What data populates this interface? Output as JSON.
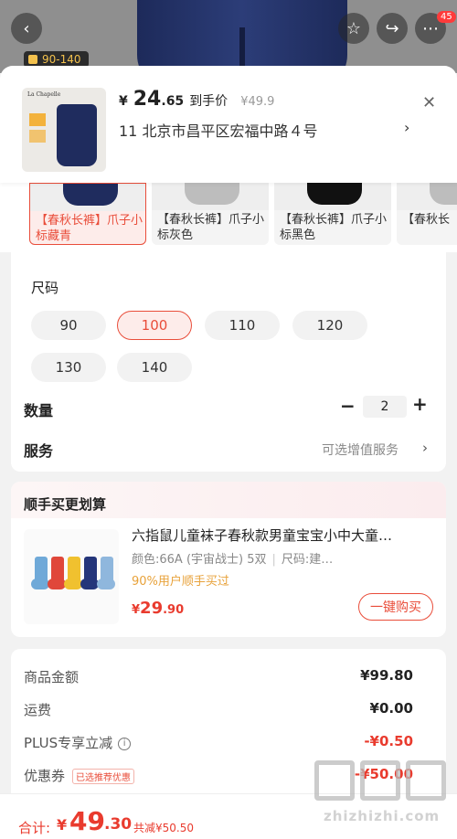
{
  "top": {
    "size_tag": "90-140",
    "cart_badge": "45"
  },
  "header": {
    "thumb_brand": "La Chapelle",
    "price_currency": "¥",
    "price_int": "24",
    "price_dec": ".65",
    "price_note": "到手价",
    "original_price": "¥49.9",
    "address": "11  北京市昌平区宏福中路４号"
  },
  "variants": [
    {
      "label": "【春秋长裤】爪子小标藏青",
      "color": "#1f2c5e",
      "selected": true
    },
    {
      "label": "【春秋长裤】爪子小标灰色",
      "color": "#bdbdbd",
      "selected": false
    },
    {
      "label": "【春秋长裤】爪子小标黑色",
      "color": "#111111",
      "selected": false
    },
    {
      "label": "【春秋长",
      "color": "#bdbdbd",
      "selected": false
    }
  ],
  "size": {
    "title": "尺码",
    "options": [
      "90",
      "100",
      "110",
      "120",
      "130",
      "140"
    ],
    "selected": "100"
  },
  "quantity": {
    "label": "数量",
    "minus": "−",
    "value": "2",
    "plus": "+"
  },
  "service": {
    "label": "服务",
    "value": "可选增值服务",
    "chevron": "›"
  },
  "bundle": {
    "title": "顺手买更划算",
    "name": "六指鼠儿童袜子春秋款男童宝宝小中大童…",
    "attr_color": "颜色:66A (宇宙战士) 5双",
    "attr_size": "尺码:建…",
    "social": "90%用户顺手买过",
    "price_currency": "¥",
    "price_int": "29",
    "price_dec": ".90",
    "buy_label": "一键购买"
  },
  "summary": {
    "goods_label": "商品金额",
    "goods_value": "¥99.80",
    "shipping_label": "运费",
    "shipping_value": "¥0.00",
    "plus_label": "PLUS专享立减",
    "plus_value": "-¥0.50",
    "coupon_label": "优惠券",
    "coupon_tag": "已选推荐优惠",
    "coupon_value": "-¥50.00"
  },
  "bottom": {
    "total_label": "合计:",
    "total_currency": "¥",
    "total_int": "49",
    "total_dec": ".30",
    "saved": "共减¥50.50"
  },
  "watermark": {
    "text": "zhizhizhi.com"
  },
  "colors": {
    "accent": "#e94d3a",
    "price_red": "#e93b2e",
    "navy": "#1f2c5e"
  }
}
